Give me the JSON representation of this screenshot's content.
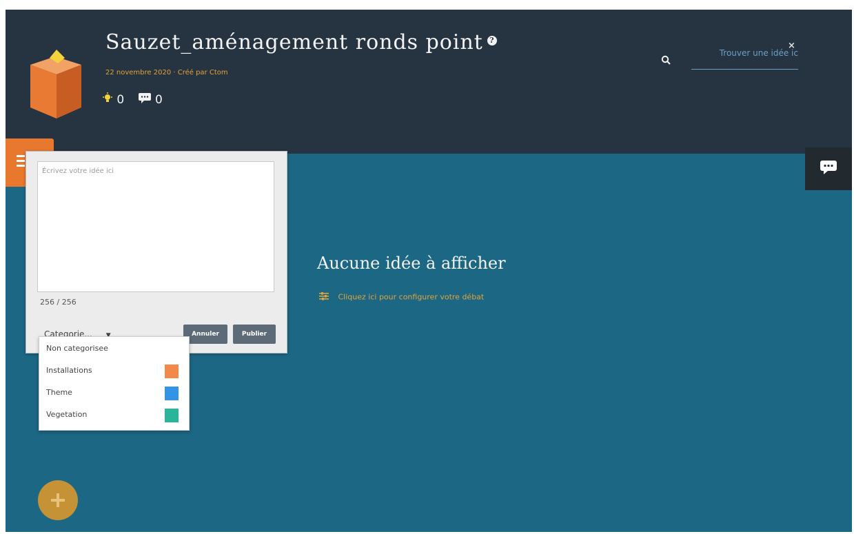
{
  "header": {
    "title": "Sauzet_aménagement ronds point",
    "subtitle": "22 novembre 2020 · Créé par Ctom",
    "ideas_count": "0",
    "comments_count": "0"
  },
  "search": {
    "placeholder": "Trouver une idée ic"
  },
  "idea_form": {
    "placeholder": "Écrivez votre idée ici",
    "char_count": "256 / 256",
    "category_label": "Categorie...",
    "cancel_label": "Annuler",
    "publish_label": "Publier"
  },
  "category_dropdown": {
    "items": [
      {
        "label": "Non categorisee"
      },
      {
        "label": "Installations",
        "color": "#f2894a"
      },
      {
        "label": "Theme",
        "color": "#3393e6"
      },
      {
        "label": "Vegetation",
        "color": "#2ab59a"
      }
    ]
  },
  "main": {
    "empty_title": "Aucune idée à afficher",
    "config_link": "Cliquez ici pour configurer votre débat"
  },
  "colors": {
    "header_bg": "#263340",
    "board_bg": "#1c6784",
    "accent_orange": "#e9782f",
    "accent_gold": "#e0a43a"
  },
  "icons": [
    "box-logo-icon",
    "help-icon",
    "lightbulb-icon",
    "comment-icon",
    "search-icon",
    "close-icon",
    "menu-icon",
    "chat-icon",
    "sliders-icon",
    "plus-icon",
    "caret-down-icon"
  ]
}
